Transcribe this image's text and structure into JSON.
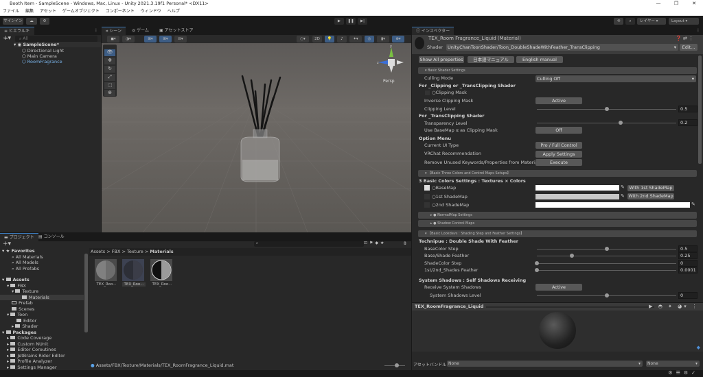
{
  "window": {
    "title": "Booth Item - SampleScene - Windows, Mac, Linux - Unity 2021.3.19f1 Personal* <DX11>"
  },
  "menu": [
    "ファイル",
    "編集",
    "アセット",
    "ゲームオブジェクト",
    "コンポーネント",
    "ウィンドウ",
    "ヘルプ"
  ],
  "toolbar": {
    "signin": "サインイン",
    "layers": "レイヤー",
    "layout": "Layout"
  },
  "hierarchy": {
    "tab": "ヒエラルキー",
    "search_placeholder": "All",
    "scene": "SampleScene*",
    "items": [
      "Directional Light",
      "Main Camera",
      "RoomFragrance"
    ]
  },
  "scene": {
    "tabs": [
      "シーン",
      "ゲーム",
      "アセットストア"
    ],
    "mode_2d": "2D",
    "persp": "Persp",
    "gizmo_y": "y",
    "gizmo_z": "z"
  },
  "project": {
    "tabs": [
      "プロジェクト",
      "コンソール"
    ],
    "favorites": {
      "label": "Favorites",
      "items": [
        "All Materials",
        "All Models",
        "All Prefabs"
      ]
    },
    "assets": {
      "label": "Assets",
      "items": [
        {
          "name": "FBX",
          "depth": 1
        },
        {
          "name": "Texture",
          "depth": 2
        },
        {
          "name": "Materials",
          "depth": 3
        },
        {
          "name": "Prefab",
          "depth": 1
        },
        {
          "name": "Scenes",
          "depth": 1
        },
        {
          "name": "Toon",
          "depth": 1
        },
        {
          "name": "Editor",
          "depth": 2
        },
        {
          "name": "Shader",
          "depth": 2
        }
      ]
    },
    "packages": {
      "label": "Packages",
      "items": [
        "Code Coverage",
        "Custom NUnit",
        "Editor Coroutines",
        "JetBrains Rider Editor",
        "Profile Analyzer",
        "Settings Manager"
      ]
    },
    "breadcrumb": [
      "Assets",
      "FBX",
      "Texture",
      "Materials"
    ],
    "files": [
      "TEX_Roo···",
      "TEX_Roo···",
      "TEX_Roo···"
    ],
    "hidden_count": "8",
    "path": "Assets/FBX/Texture/Materials/TEX_RoomFragrance_Liquid.mat"
  },
  "inspector": {
    "tab": "インスペクター",
    "title": "TEX_Room Fragrance_Liquid (Material)",
    "shader_label": "Shader",
    "shader": "UnityChanToonShader/Toon_DoubleShadeWithFeather_TransClipping",
    "edit": "Edit...",
    "buttons": [
      "Show All properties",
      "日本語マニュアル",
      "English manual"
    ],
    "sections": [
      "Basic Shader Settings",
      "【Basic Three Colors and Control Maps Setups】",
      "NormalMap Settings",
      "Shadow Control Maps",
      "【Basic Lookdevs : Shading Step and Feather Settings】"
    ],
    "culling": {
      "label": "Culling Mode",
      "value": "Culling Off"
    },
    "h_clip": "For _Clipping or _TransClipping Shader",
    "clipping_mask": "Clipping Mask",
    "inverse": {
      "label": "Inverse Clipping Mask",
      "value": "Active"
    },
    "clipping_level": {
      "label": "Clipping Level",
      "value": "0.5",
      "num": 0.5,
      "min": 0,
      "max": 1
    },
    "h_trans": "For _TransClipping Shader",
    "transparency": {
      "label": "Transparency Level",
      "value": "0.2",
      "num": 0.2,
      "min": -1,
      "max": 1
    },
    "use_basemap": {
      "label": "Use BaseMap α as Clipping Mask",
      "value": "Off"
    },
    "h_option": "Option Menu",
    "ui_type": {
      "label": "Current UI Type",
      "value": "Pro / Full Control"
    },
    "vrchat": {
      "label": "VRChat Recommendation",
      "value": "Apply Settings"
    },
    "remove": {
      "label": "Remove Unused Keywords/Properties from Materia",
      "value": "Execute"
    },
    "h_colors": "3 Basic Colors Settings : Textures × Colors",
    "basemap": {
      "label": "BaseMap",
      "button": "With 1st ShadeMap",
      "color": "#ffffff"
    },
    "shade1": {
      "label": "1st ShadeMap",
      "button": "With 2nd ShadeMap",
      "color": "#c8c8c8"
    },
    "shade2": {
      "label": "2nd ShadeMap",
      "color": "#ffffff"
    },
    "h_tech": "Technipue : Double Shade With Feather",
    "basecolor_step": {
      "label": "BaseColor Step",
      "value": "0.5",
      "num": 0.5,
      "min": 0,
      "max": 1
    },
    "base_shade_feather": {
      "label": "Base/Shade Feather",
      "value": "0.25",
      "num": 0.25,
      "min": 0,
      "max": 1
    },
    "shadecolor_step": {
      "label": "ShadeColor Step",
      "value": "0",
      "num": 0,
      "min": 0,
      "max": 1
    },
    "shades_feather": {
      "label": "1st/2nd_Shades Feather",
      "value": "0.0001",
      "num": 0.0001,
      "min": 0,
      "max": 1
    },
    "h_shadows": "System Shadows : Self Shadows Receiving",
    "receive": {
      "label": "Receive System Shadows",
      "value": "Active"
    },
    "shadow_level": {
      "label": "System Shadows Level",
      "value": "0",
      "num": 0,
      "min": -0.5,
      "max": 0.5
    },
    "preview_title": "TEX_RoomFragrance_Liquid",
    "asset_bundle": {
      "label": "アセットバンドル",
      "value1": "None",
      "value2": "None"
    }
  }
}
